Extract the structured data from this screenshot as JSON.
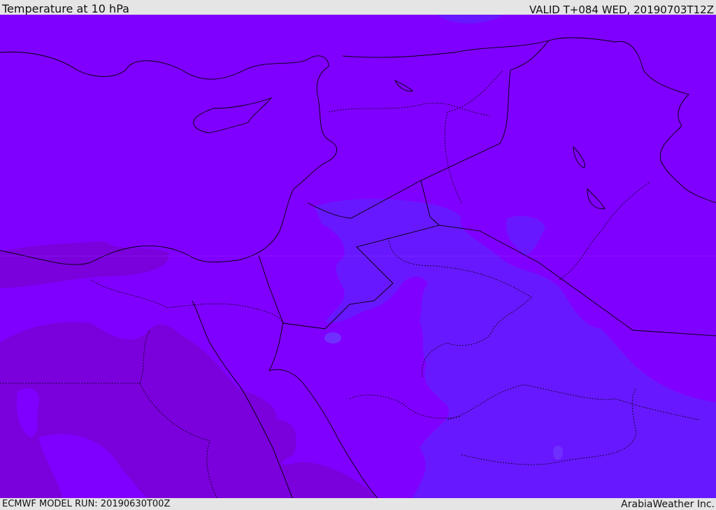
{
  "header": {
    "title": "Temperature at 10 hPa",
    "valid": "VALID T+084 WED, 20190703T12Z"
  },
  "footer": {
    "model_run": "ECMWF MODEL RUN: 20190630T00Z",
    "credit": "ArabiaWeather Inc."
  },
  "map": {
    "colors": {
      "base": "#8000ff",
      "cooler_west": "#7a00dc",
      "warmer_east": "#6818ff",
      "spot": "#6f30ff"
    }
  }
}
